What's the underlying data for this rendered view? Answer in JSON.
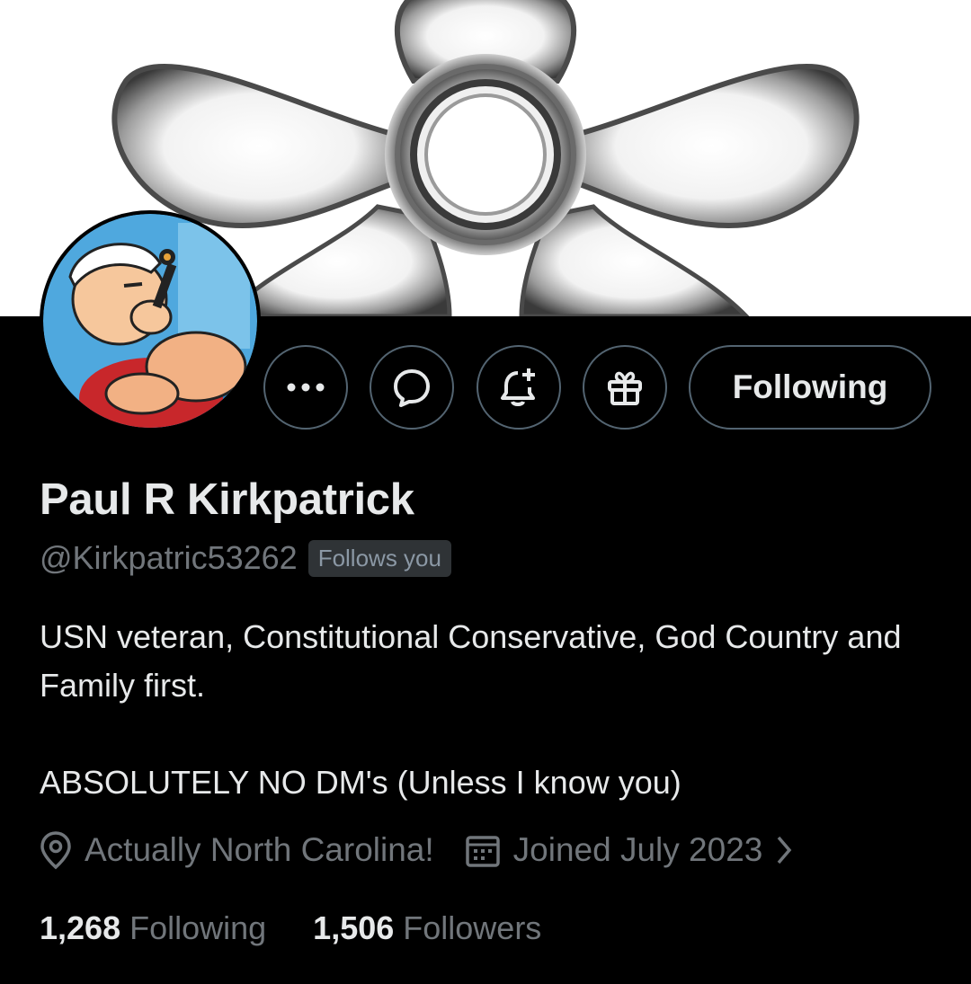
{
  "profile": {
    "name": "Paul R Kirkpatrick",
    "handle": "@Kirkpatric53262",
    "follows_you_badge": "Follows you",
    "bio": "USN veteran, Constitutional Conservative, God Country and Family first.\n\nABSOLUTELY NO DM's (Unless I know you)",
    "location": "Actually North Carolina!",
    "joined": "Joined July 2023"
  },
  "actions": {
    "following_label": "Following",
    "more_icon": "more-icon",
    "message_icon": "message-icon",
    "notify_icon": "bell-plus-icon",
    "gift_icon": "gift-icon"
  },
  "stats": {
    "following_count": "1,268",
    "following_label": "Following",
    "followers_count": "1,506",
    "followers_label": "Followers"
  },
  "colors": {
    "background": "#000000",
    "primary_text": "#e7e9ea",
    "secondary_text": "#71767b",
    "border": "#536471"
  }
}
